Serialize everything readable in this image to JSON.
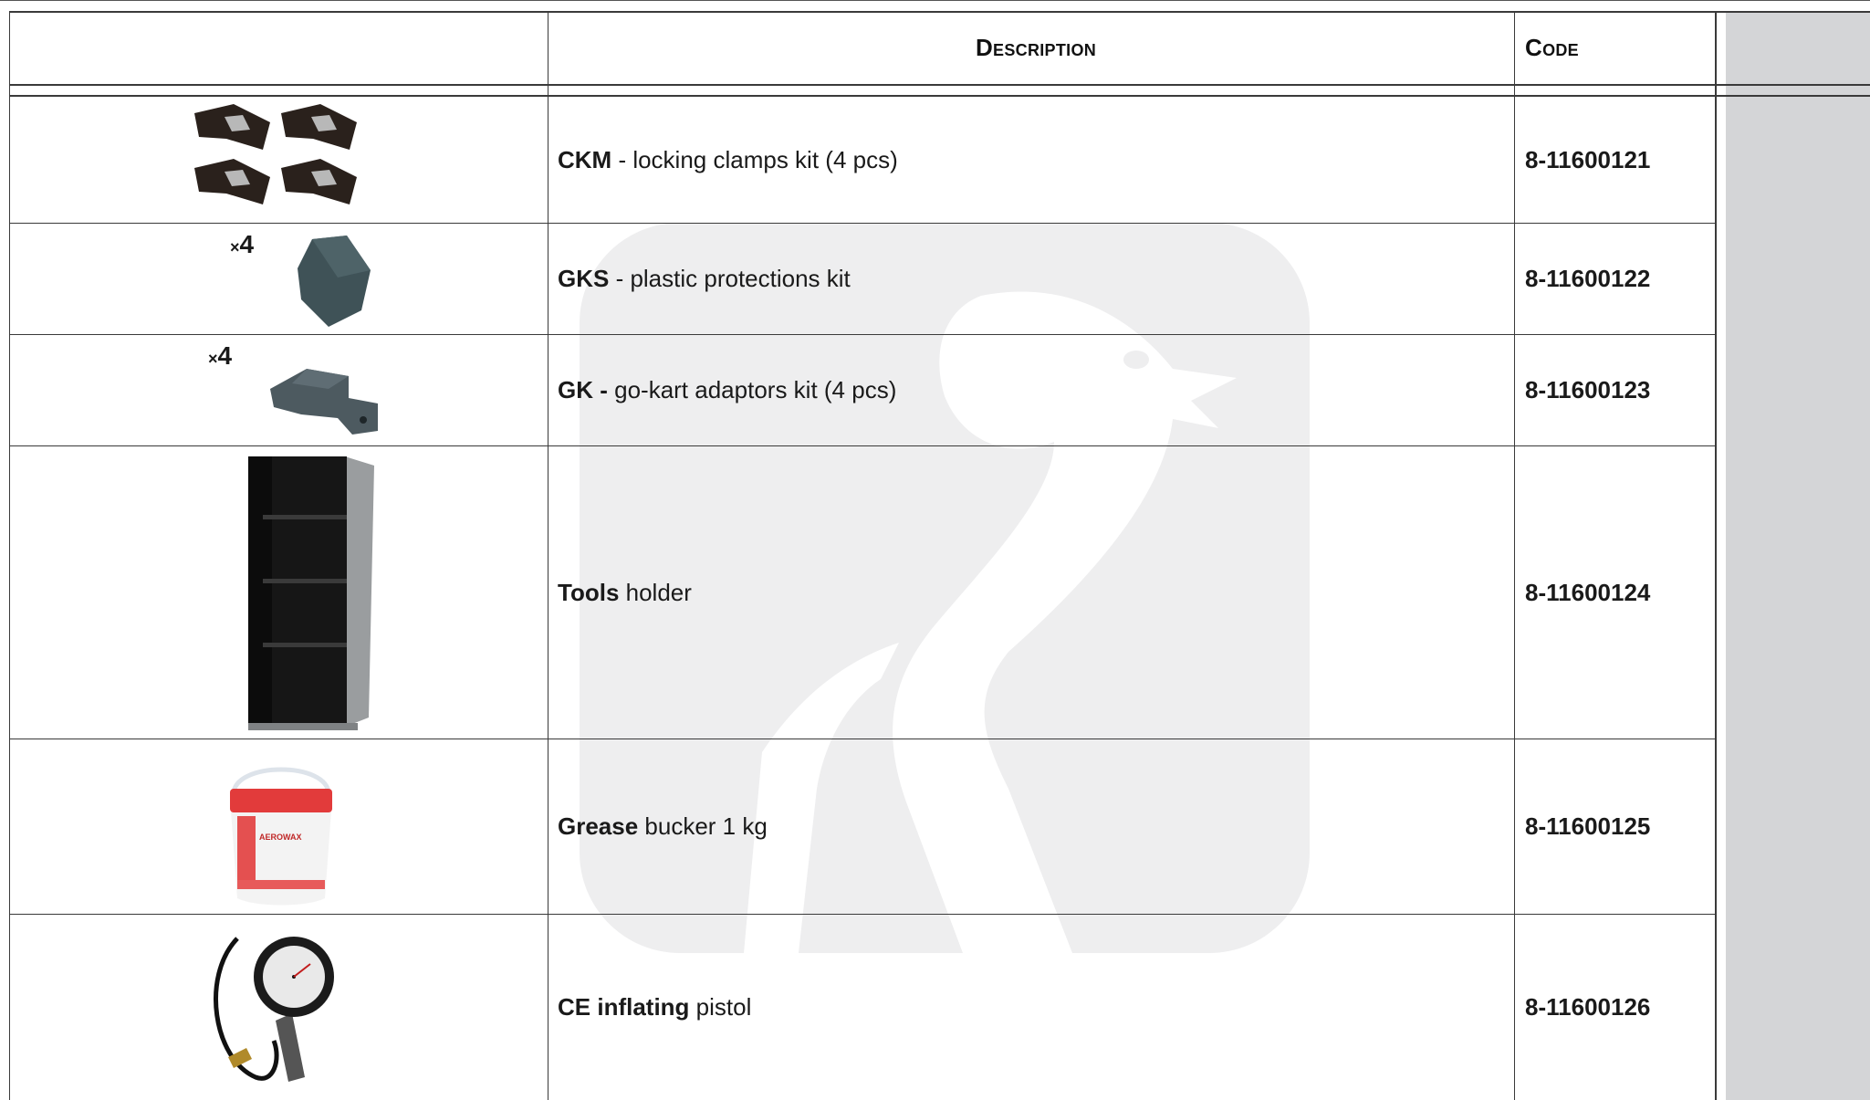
{
  "header": {
    "description_label": "Description",
    "code_label": "Code"
  },
  "rows": [
    {
      "bold": "CKM",
      "text": " - locking clamps kit (4 pcs)",
      "code": "8-11600121",
      "image": "locking-clamps-image",
      "qty": null
    },
    {
      "bold": "GKS",
      "text": " - plastic protections kit",
      "code": "8-11600122",
      "image": "plastic-protection-image",
      "qty": "4"
    },
    {
      "bold": "GK -",
      "text": " go-kart adaptors kit (4 pcs)",
      "code": "8-11600123",
      "image": "go-kart-adaptor-image",
      "qty": "4"
    },
    {
      "bold": "Tools",
      "text": " holder",
      "code": "8-11600124",
      "image": "tools-holder-image",
      "qty": null
    },
    {
      "bold": "Grease",
      "text": " bucker 1 kg",
      "code": "8-11600125",
      "image": "grease-bucket-image",
      "qty": null
    },
    {
      "bold": "CE inflating",
      "text": " pistol",
      "code": "8-11600126",
      "image": "inflating-pistol-image",
      "qty": null
    }
  ],
  "qty_prefix": "×",
  "bucket_label": "AEROWAX",
  "colors": {
    "shade": "#d4d5d7",
    "watermark": "#eeeeef",
    "border": "#3a3a3a"
  }
}
